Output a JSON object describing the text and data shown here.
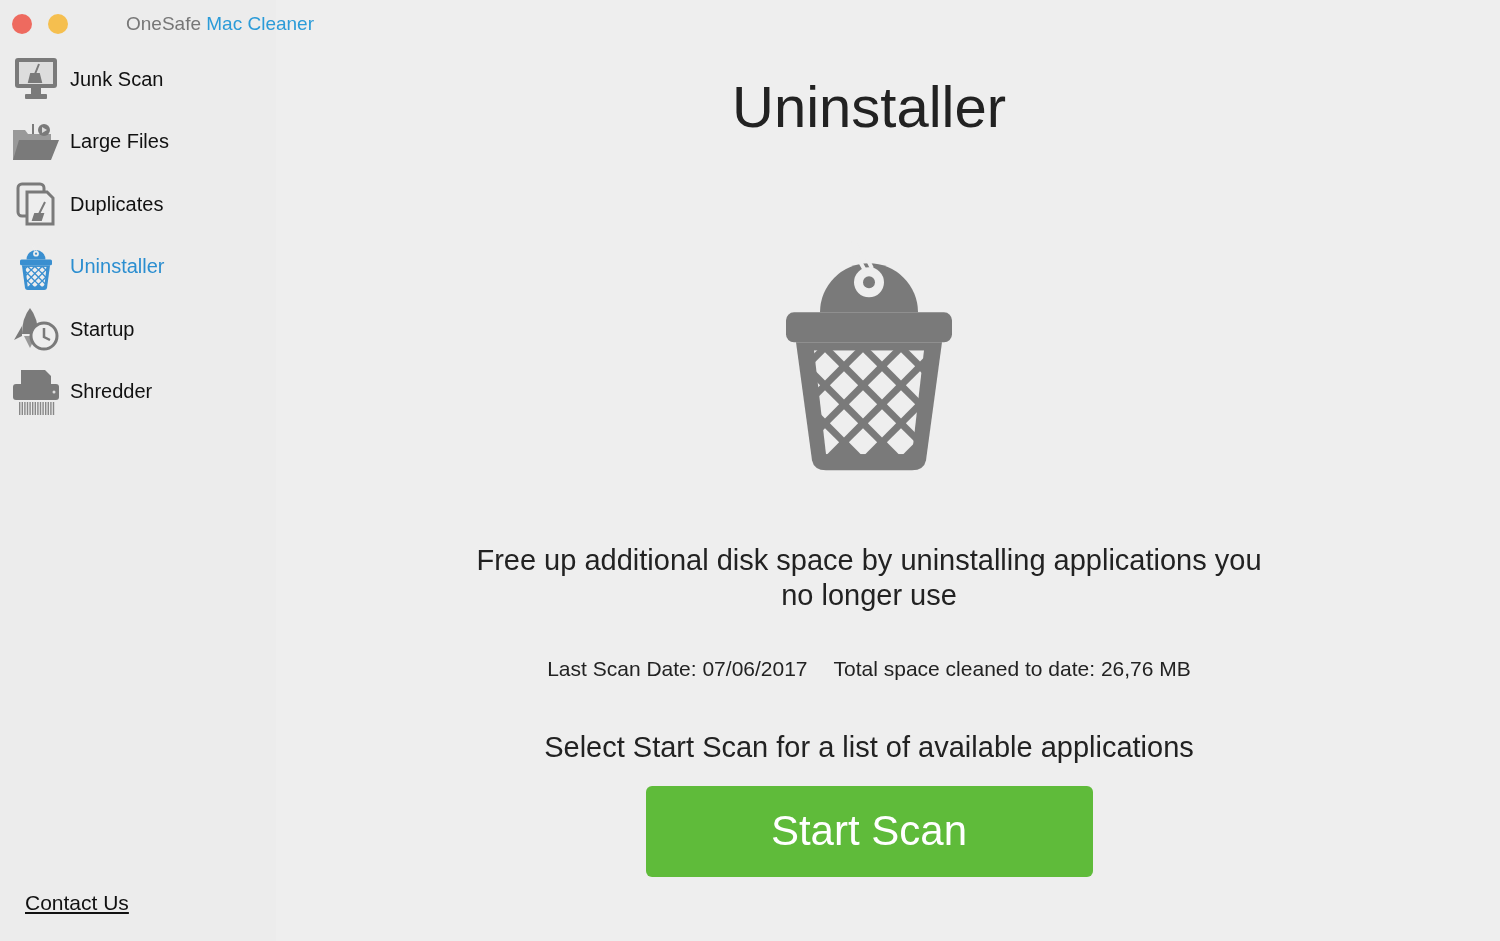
{
  "window": {
    "title_brand": "OneSafe",
    "title_product": "Mac Cleaner",
    "buttons": [
      {
        "kind": "close"
      },
      {
        "kind": "minimize"
      }
    ]
  },
  "sidebar": {
    "items": [
      {
        "label": "Junk Scan",
        "kind": "monitor",
        "selected": false
      },
      {
        "label": "Large Files",
        "kind": "folder",
        "selected": false
      },
      {
        "label": "Duplicates",
        "kind": "copies",
        "selected": false
      },
      {
        "label": "Uninstaller",
        "kind": "bin",
        "selected": true
      },
      {
        "label": "Startup",
        "kind": "rocket",
        "selected": false
      },
      {
        "label": "Shredder",
        "kind": "shredder",
        "selected": false
      }
    ],
    "footer_link": "Contact Us"
  },
  "main": {
    "heading": "Uninstaller",
    "description": "Free up additional disk space by uninstalling applications you no longer use",
    "last_scan": "Last Scan Date: 07/06/2017",
    "total_cleaned": "Total space cleaned to date: 26,76 MB",
    "prompt": "Select Start Scan for a list of available applications",
    "button": "Start Scan"
  }
}
